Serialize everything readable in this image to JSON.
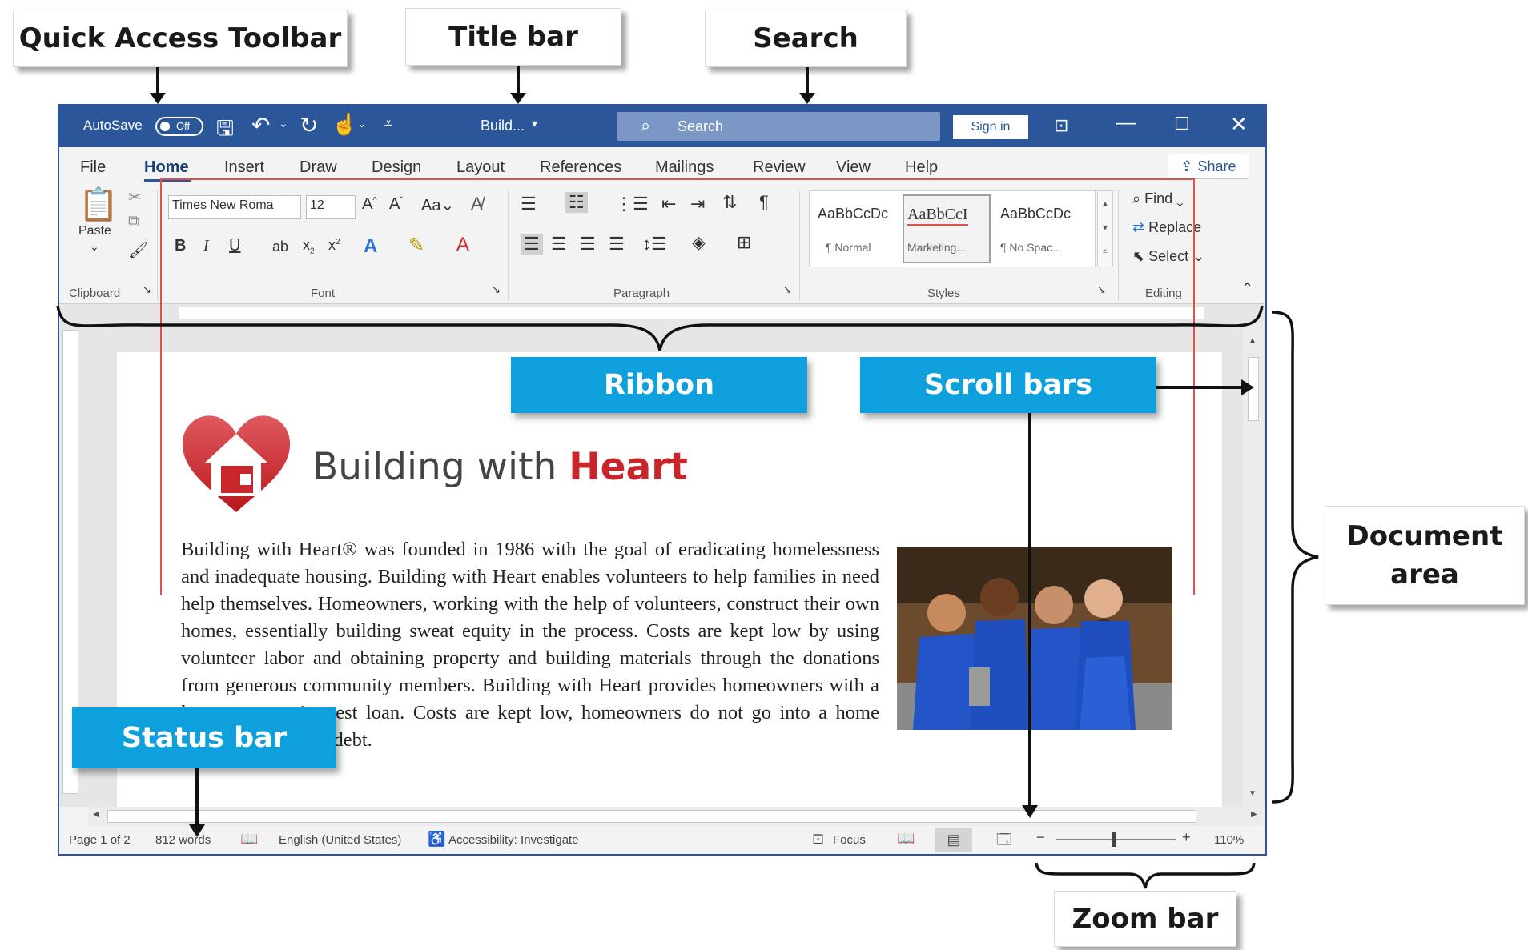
{
  "callouts": {
    "quick_access_toolbar": "Quick Access Toolbar",
    "title_bar": "Title bar",
    "search": "Search",
    "ribbon": "Ribbon",
    "scroll_bars": "Scroll bars",
    "document_area_line1": "Document",
    "document_area_line2": "area",
    "status_bar": "Status bar",
    "zoom_bar": "Zoom bar"
  },
  "titlebar": {
    "autosave_label": "AutoSave",
    "autosave_state": "Off",
    "doc_title": "Build...",
    "search_placeholder": "Search",
    "sign_in": "Sign in",
    "colors": {
      "bar": "#2b579a",
      "search_box": "#7a97c5"
    }
  },
  "tabs": [
    "File",
    "Home",
    "Insert",
    "Draw",
    "Design",
    "Layout",
    "References",
    "Mailings",
    "Review",
    "View",
    "Help"
  ],
  "active_tab": "Home",
  "share_label": "Share",
  "ribbon": {
    "clipboard": {
      "paste": "Paste",
      "group": "Clipboard"
    },
    "font": {
      "name": "Times New Roma",
      "size": "12",
      "group": "Font",
      "bold": "B",
      "italic": "I",
      "underline": "U",
      "case": "Aa"
    },
    "paragraph": {
      "group": "Paragraph"
    },
    "styles": {
      "group": "Styles",
      "items": [
        {
          "preview": "AaBbCcDc",
          "name": "¶ Normal"
        },
        {
          "preview": "AaBbCcI",
          "name": "Marketing..."
        },
        {
          "preview": "AaBbCcDc",
          "name": "¶ No Spac..."
        }
      ]
    },
    "editing": {
      "group": "Editing",
      "find": "Find",
      "replace": "Replace",
      "select": "Select"
    }
  },
  "document": {
    "heading_plain": "Building with ",
    "heading_bold": "Heart",
    "body_text": "Building with Heart® was founded in 1986 with the goal of eradicating homelessness and inadequate housing. Building with Heart enables volunteers to help families in need help themselves. Homeowners, working with the help of volunteers, construct their own homes, essentially building sweat equity in the process. Costs are kept low by using volunteer labor and obtaining property and building materials through the donations from generous community members. Building with Heart provides homeowners with a long-term, no interest loan. Costs are kept low, homeowners do not go into a home overburdened with debt.",
    "accent_color": "#c8262b"
  },
  "statusbar": {
    "page": "Page 1 of 2",
    "words": "812 words",
    "language": "English (United States)",
    "accessibility": "Accessibility: Investigate",
    "focus": "Focus",
    "zoom": "110%"
  }
}
